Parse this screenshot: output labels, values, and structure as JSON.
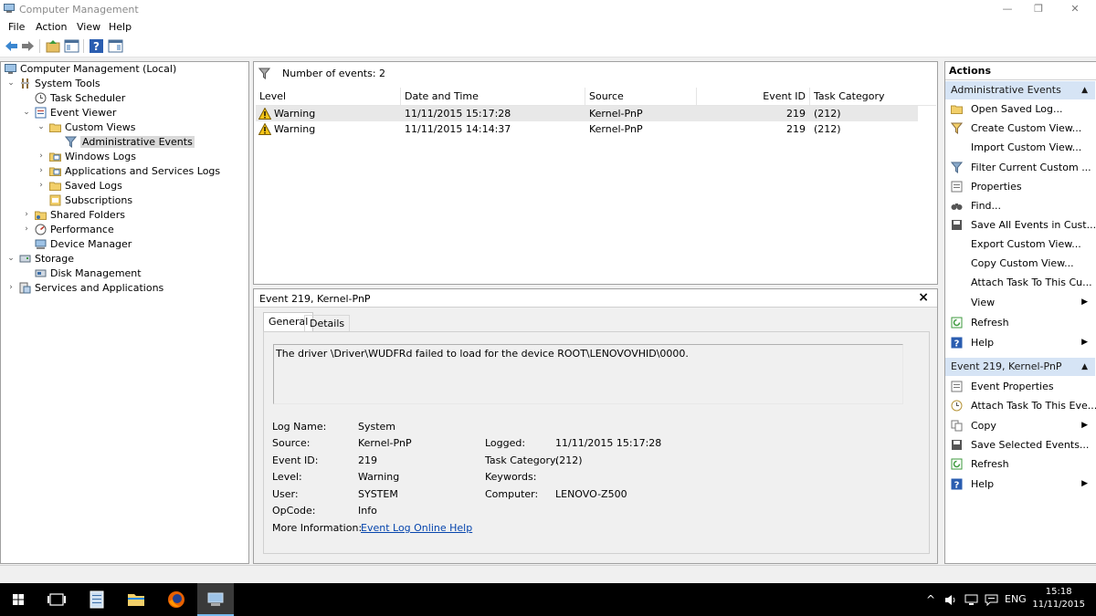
{
  "window": {
    "title": "Computer Management"
  },
  "menu": [
    "File",
    "Action",
    "View",
    "Help"
  ],
  "tree": {
    "root": "Computer Management (Local)",
    "system_tools": "System Tools",
    "task_scheduler": "Task Scheduler",
    "event_viewer": "Event Viewer",
    "custom_views": "Custom Views",
    "administrative_events": "Administrative Events",
    "windows_logs": "Windows Logs",
    "app_services_logs": "Applications and Services Logs",
    "saved_logs": "Saved Logs",
    "subscriptions": "Subscriptions",
    "shared_folders": "Shared Folders",
    "performance": "Performance",
    "device_manager": "Device Manager",
    "storage": "Storage",
    "disk_management": "Disk Management",
    "services_apps": "Services and Applications"
  },
  "events": {
    "count_label": "Number of events: 2",
    "columns": [
      "Level",
      "Date and Time",
      "Source",
      "Event ID",
      "Task Category"
    ],
    "rows": [
      {
        "level": "Warning",
        "datetime": "11/11/2015 15:17:28",
        "source": "Kernel-PnP",
        "event_id": "219",
        "category": "(212)"
      },
      {
        "level": "Warning",
        "datetime": "11/11/2015 14:14:37",
        "source": "Kernel-PnP",
        "event_id": "219",
        "category": "(212)"
      }
    ]
  },
  "detail": {
    "header": "Event 219, Kernel-PnP",
    "close": "×",
    "tabs": [
      "General",
      "Details"
    ],
    "message": "The driver \\Driver\\WUDFRd failed to load for the device ROOT\\LENOVOVHID\\0000.",
    "labels": {
      "log_name": "Log Name:",
      "source": "Source:",
      "event_id": "Event ID:",
      "level": "Level:",
      "user": "User:",
      "opcode": "OpCode:",
      "more_info": "More Information:",
      "logged": "Logged:",
      "task_category": "Task Category:",
      "keywords": "Keywords:",
      "computer": "Computer:"
    },
    "values": {
      "log_name": "System",
      "source": "Kernel-PnP",
      "event_id": "219",
      "level": "Warning",
      "user": "SYSTEM",
      "opcode": "Info",
      "more_info_link": "Event Log Online Help",
      "logged": "11/11/2015 15:17:28",
      "task_category": "(212)",
      "keywords": "",
      "computer": "LENOVO-Z500"
    }
  },
  "actions": {
    "title": "Actions",
    "section1": {
      "header": "Administrative Events",
      "items": [
        "Open Saved Log...",
        "Create Custom View...",
        "Import Custom View...",
        "Filter Current Custom ...",
        "Properties",
        "Find...",
        "Save All Events in Cust...",
        "Export Custom View...",
        "Copy Custom View...",
        "Attach Task To This Cu...",
        "View",
        "Refresh",
        "Help"
      ]
    },
    "section2": {
      "header": "Event 219, Kernel-PnP",
      "items": [
        "Event Properties",
        "Attach Task To This Eve...",
        "Copy",
        "Save Selected Events...",
        "Refresh",
        "Help"
      ]
    }
  },
  "taskbar": {
    "language": "ENG",
    "time": "15:18",
    "date": "11/11/2015"
  },
  "colors": {
    "selection": "#d9d9d9",
    "action_header": "#d6e4f5",
    "link": "#0645ad",
    "taskbar": "#000000"
  }
}
